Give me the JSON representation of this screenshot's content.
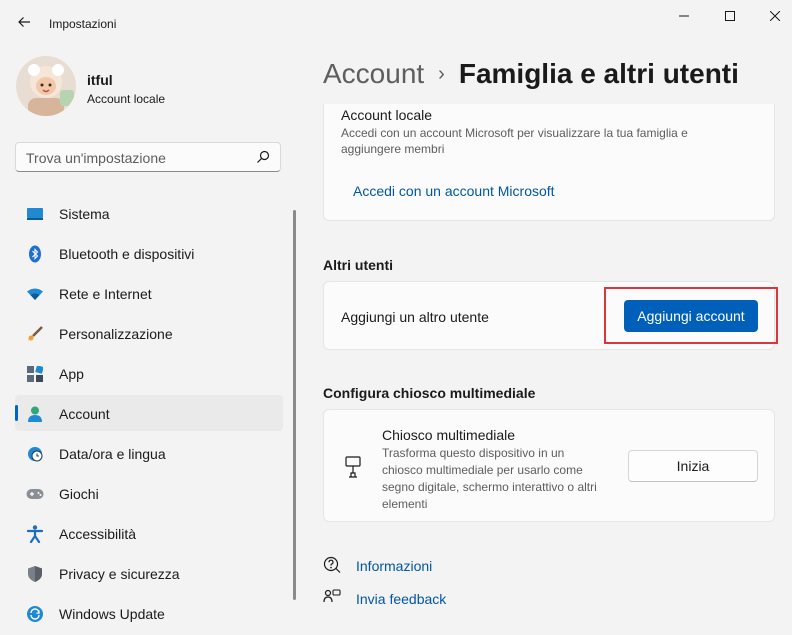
{
  "window": {
    "app_title": "Impostazioni"
  },
  "profile": {
    "name": "itful",
    "account_type": "Account locale"
  },
  "search": {
    "placeholder": "Trova un'impostazione"
  },
  "sidebar": {
    "items": [
      {
        "label": "Sistema",
        "icon": "monitor-icon"
      },
      {
        "label": "Bluetooth e dispositivi",
        "icon": "bluetooth-icon"
      },
      {
        "label": "Rete e Internet",
        "icon": "wifi-icon"
      },
      {
        "label": "Personalizzazione",
        "icon": "brush-icon"
      },
      {
        "label": "App",
        "icon": "apps-icon"
      },
      {
        "label": "Account",
        "icon": "person-icon",
        "active": true
      },
      {
        "label": "Data/ora e lingua",
        "icon": "globe-clock-icon"
      },
      {
        "label": "Giochi",
        "icon": "gamepad-icon"
      },
      {
        "label": "Accessibilità",
        "icon": "accessibility-icon"
      },
      {
        "label": "Privacy e sicurezza",
        "icon": "shield-icon"
      },
      {
        "label": "Windows Update",
        "icon": "update-icon"
      }
    ]
  },
  "breadcrumb": {
    "parent": "Account",
    "separator": "›",
    "current": "Famiglia e altri utenti"
  },
  "microsoft_account": {
    "title": "Account locale",
    "description": "Accedi con un account Microsoft per visualizzare la tua famiglia e aggiungere membri",
    "link": "Accedi con un account Microsoft"
  },
  "other_users": {
    "heading": "Altri utenti",
    "label": "Aggiungi un altro utente",
    "button": "Aggiungi account"
  },
  "kiosk": {
    "heading": "Configura chiosco multimediale",
    "title": "Chiosco multimediale",
    "description": "Trasforma questo dispositivo in un chiosco multimediale per usarlo come segno digitale, schermo interattivo o altri elementi",
    "button": "Inizia"
  },
  "help": {
    "info": "Informazioni",
    "feedback": "Invia feedback"
  },
  "colors": {
    "accent": "#005fb8",
    "highlight": "#d9363e",
    "link": "#0056a3"
  }
}
